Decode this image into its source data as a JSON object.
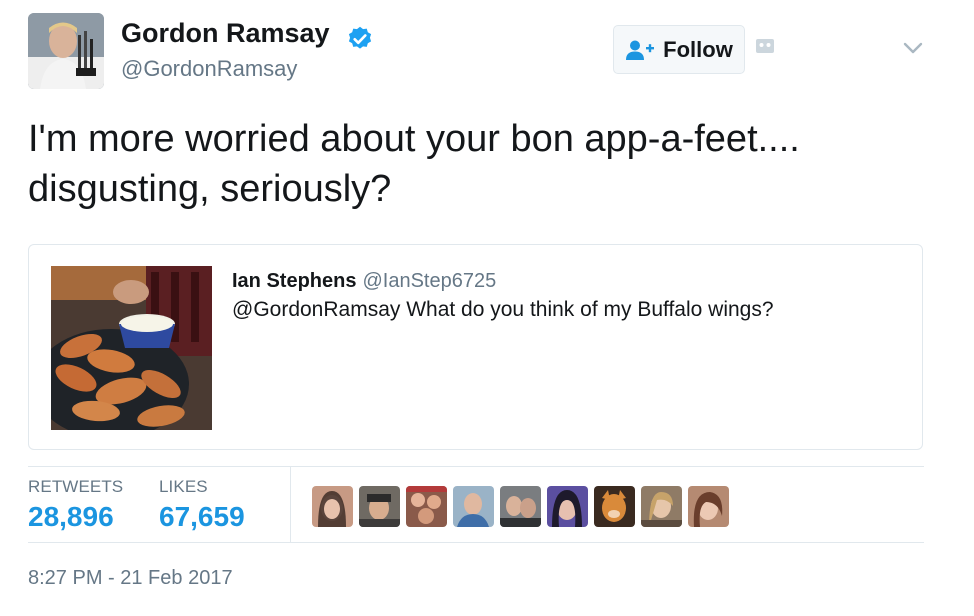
{
  "author": {
    "display_name": "Gordon Ramsay",
    "handle": "@GordonRamsay",
    "verified": true
  },
  "follow_button": {
    "label": "Follow"
  },
  "tweet": {
    "text": "I'm more worried about your  bon app-a-feet....\ndisgusting, seriously?"
  },
  "quoted_tweet": {
    "author_name": "Ian Stephens",
    "author_handle": "@IanStep6725",
    "text": "@GordonRamsay What do you think of my Buffalo wings?"
  },
  "stats": {
    "retweets_label": "RETWEETS",
    "retweets_value": "28,896",
    "likes_label": "LIKES",
    "likes_value": "67,659"
  },
  "likers_count_shown": 9,
  "timestamp": "8:27 PM - 21 Feb 2017",
  "colors": {
    "accent": "#1b95e0",
    "verified": "#1da1f2",
    "secondary_text": "#657786",
    "border": "#e1e8ed"
  },
  "icons": {
    "verified": "verified-badge-icon",
    "follow": "follow-user-plus-icon",
    "caret": "chevron-down-icon",
    "notice": "notice-icon"
  }
}
